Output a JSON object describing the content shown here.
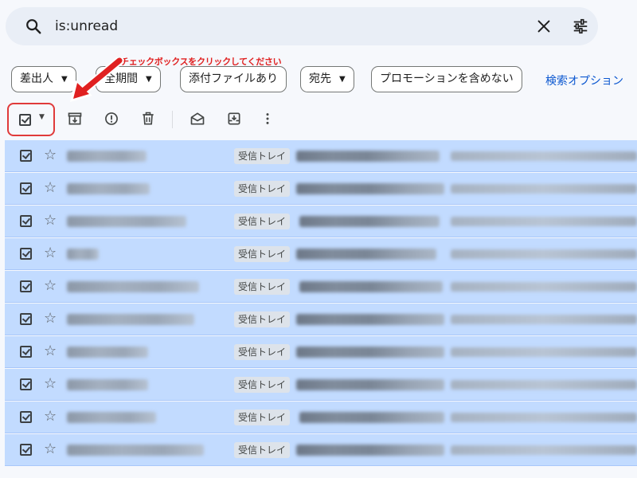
{
  "search": {
    "query": "is:unread",
    "icons": [
      "search-icon",
      "clear-icon",
      "tune-icon"
    ]
  },
  "annotation": {
    "text": "チェックボックスをクリックしてください",
    "color": "#e02020"
  },
  "filters": {
    "chips": [
      {
        "label": "差出人",
        "dropdown": true
      },
      {
        "label": "全期間",
        "dropdown": true
      },
      {
        "label": "添付ファイルあり",
        "dropdown": false
      },
      {
        "label": "宛先",
        "dropdown": true
      },
      {
        "label": "プロモーションを含めない",
        "dropdown": false
      }
    ],
    "advanced_link": "検索オプション"
  },
  "toolbar": {
    "icons": [
      "select-all-checkbox-icon",
      "archive-icon",
      "report-spam-icon",
      "delete-icon",
      "mark-as-read-icon",
      "move-to-inbox-icon",
      "more-vert-icon"
    ],
    "selection_state": "all-checked"
  },
  "messages": [
    {
      "checked": true,
      "starred": false,
      "label": "受信トレイ"
    },
    {
      "checked": true,
      "starred": false,
      "label": "受信トレイ"
    },
    {
      "checked": true,
      "starred": false,
      "label": "受信トレイ"
    },
    {
      "checked": true,
      "starred": false,
      "label": "受信トレイ"
    },
    {
      "checked": true,
      "starred": false,
      "label": "受信トレイ"
    },
    {
      "checked": true,
      "starred": false,
      "label": "受信トレイ"
    },
    {
      "checked": true,
      "starred": false,
      "label": "受信トレイ"
    },
    {
      "checked": true,
      "starred": false,
      "label": "受信トレイ"
    },
    {
      "checked": true,
      "starred": false,
      "label": "受信トレイ"
    },
    {
      "checked": true,
      "starred": false,
      "label": "受信トレイ"
    }
  ],
  "colors": {
    "selected_row": "#c2dbff",
    "link": "#0b57d0",
    "highlight_box": "#e03a3a",
    "search_bg": "#e9eef6"
  }
}
